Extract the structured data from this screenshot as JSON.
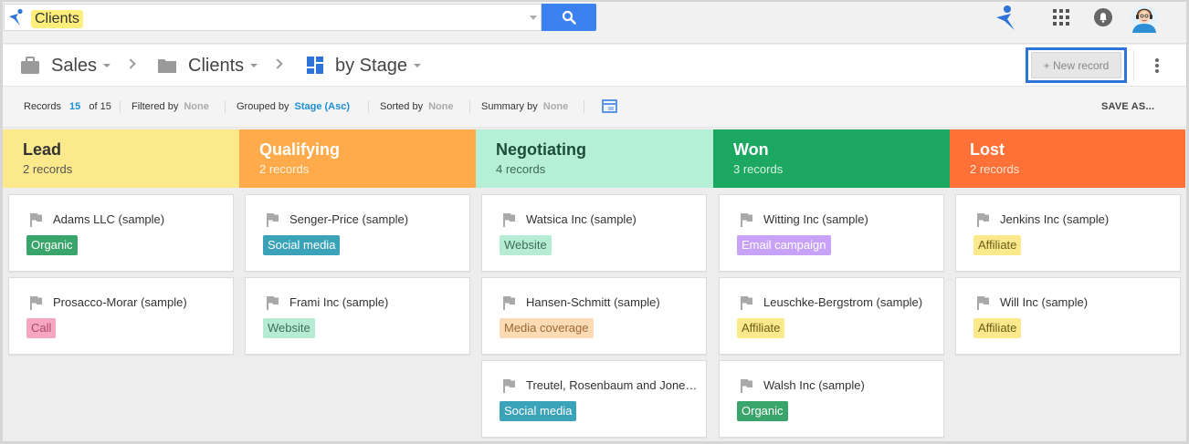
{
  "search": {
    "query_chip": "Clients"
  },
  "breadcrumb": [
    {
      "label": "Sales",
      "icon": "briefcase-icon"
    },
    {
      "label": "Clients",
      "icon": "folder-icon"
    },
    {
      "label": "by Stage",
      "icon": "kanban-view-icon"
    }
  ],
  "toolbar": {
    "new_record_label": "+ New record"
  },
  "filterbar": {
    "records_label": "Records",
    "records_count": "15",
    "records_of": "of 15",
    "filtered_label": "Filtered by",
    "filtered_value": "None",
    "grouped_label": "Grouped by",
    "grouped_value": "Stage (Asc)",
    "sorted_label": "Sorted by",
    "sorted_value": "None",
    "summary_label": "Summary by",
    "summary_value": "None",
    "save_as_label": "SAVE AS..."
  },
  "columns": [
    {
      "title": "Lead",
      "count": "2 records",
      "bg": "#fce98b",
      "fg": "#333333",
      "count_fg": "#555555",
      "cards": [
        {
          "name": "Adams LLC (sample)",
          "tag": "Organic",
          "tag_bg": "#3aa56a",
          "tag_fg": "#ffffff"
        },
        {
          "name": "Prosacco-Morar (sample)",
          "tag": "Call",
          "tag_bg": "#f6a6c1",
          "tag_fg": "#b0476f"
        }
      ]
    },
    {
      "title": "Qualifying",
      "count": "2 records",
      "bg": "#ffab4b",
      "fg": "#ffffff",
      "count_fg": "#fff3e3",
      "cards": [
        {
          "name": "Senger-Price (sample)",
          "tag": "Social media",
          "tag_bg": "#3aa3ba",
          "tag_fg": "#ffffff"
        },
        {
          "name": "Frami Inc (sample)",
          "tag": "Website",
          "tag_bg": "#b7ecd4",
          "tag_fg": "#3a6f58"
        }
      ]
    },
    {
      "title": "Negotiating",
      "count": "4 records",
      "bg": "#b5f0d6",
      "fg": "#1d4d39",
      "count_fg": "#3d6655",
      "cards": [
        {
          "name": "Watsica Inc (sample)",
          "tag": "Website",
          "tag_bg": "#b7ecd4",
          "tag_fg": "#3a6f58"
        },
        {
          "name": "Hansen-Schmitt (sample)",
          "tag": "Media coverage",
          "tag_bg": "#fcdbb5",
          "tag_fg": "#9a6a34"
        },
        {
          "name": "Treutel, Rosenbaum and Jones (sample)",
          "tag": "Social media",
          "tag_bg": "#3aa3ba",
          "tag_fg": "#ffffff"
        }
      ]
    },
    {
      "title": "Won",
      "count": "3 records",
      "bg": "#1da862",
      "fg": "#ffffff",
      "count_fg": "#d8f3e4",
      "cards": [
        {
          "name": "Witting Inc (sample)",
          "tag": "Email campaign",
          "tag_bg": "#c8a2f6",
          "tag_fg": "#ffffff"
        },
        {
          "name": "Leuschke-Bergstrom (sample)",
          "tag": "Affiliate",
          "tag_bg": "#fbe98c",
          "tag_fg": "#6b5e16"
        },
        {
          "name": "Walsh Inc (sample)",
          "tag": "Organic",
          "tag_bg": "#3aa56a",
          "tag_fg": "#ffffff"
        }
      ]
    },
    {
      "title": "Lost",
      "count": "2 records",
      "bg": "#ff7136",
      "fg": "#ffffff",
      "count_fg": "#ffe6da",
      "cards": [
        {
          "name": "Jenkins Inc (sample)",
          "tag": "Affiliate",
          "tag_bg": "#fbe98c",
          "tag_fg": "#6b5e16"
        },
        {
          "name": "Will Inc (sample)",
          "tag": "Affiliate",
          "tag_bg": "#fbe98c",
          "tag_fg": "#6b5e16"
        }
      ]
    }
  ]
}
